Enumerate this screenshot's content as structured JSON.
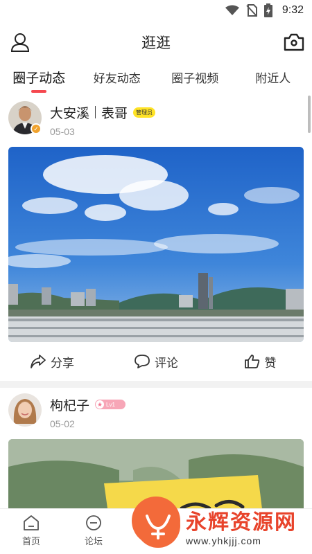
{
  "status_bar": {
    "time": "9:32"
  },
  "header": {
    "title": "逛逛"
  },
  "tabs": [
    {
      "label": "圈子动态",
      "active": true
    },
    {
      "label": "好友动态",
      "active": false
    },
    {
      "label": "圈子视频",
      "active": false
    },
    {
      "label": "附近人",
      "active": false
    }
  ],
  "posts": [
    {
      "author": "大安溪",
      "alias": "表哥",
      "badge": "管理员",
      "date": "05-03",
      "actions": {
        "share": "分享",
        "comment": "评论",
        "like": "赞"
      }
    },
    {
      "author": "枸杞子",
      "level": "Lv1",
      "date": "05-02"
    }
  ],
  "bottom_nav": [
    {
      "label": "首页",
      "icon": "home-icon"
    },
    {
      "label": "论坛",
      "icon": "forum-icon"
    },
    {
      "label": "",
      "icon": "publish-icon"
    }
  ],
  "watermark": {
    "title": "永辉资源网",
    "url": "www.yhkjjj.com"
  },
  "colors": {
    "accent": "#f5484f",
    "admin_badge": "#ffe326",
    "level_badge": "#f7a6b7",
    "watermark": "#e8432b"
  }
}
